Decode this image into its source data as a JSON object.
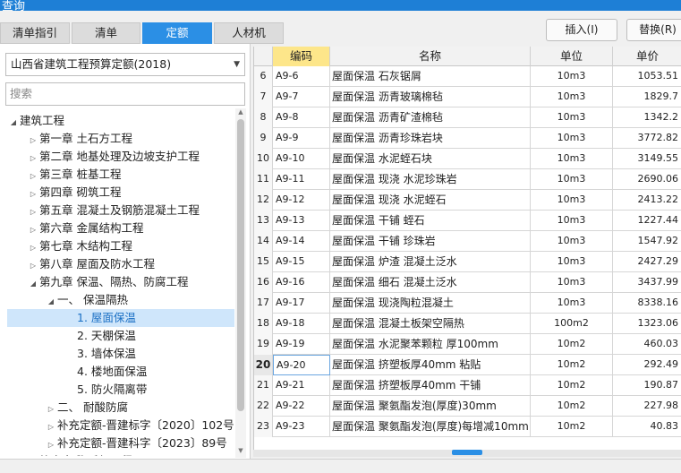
{
  "window": {
    "title": "查询"
  },
  "tabs": [
    {
      "label": "清单指引",
      "active": false
    },
    {
      "label": "清单",
      "active": false
    },
    {
      "label": "定额",
      "active": true
    },
    {
      "label": "人材机",
      "active": false
    }
  ],
  "toolbar": {
    "insert_label": "插入(I)",
    "replace_label": "替换(R)"
  },
  "left": {
    "quota_select": "山西省建筑工程预算定额(2018)",
    "search_placeholder": "搜索"
  },
  "tree": [
    {
      "label": "建筑工程",
      "arrow": "◢",
      "level": 0
    },
    {
      "label": "第一章 土石方工程",
      "arrow": "▷",
      "level": 1
    },
    {
      "label": "第二章 地基处理及边坡支护工程",
      "arrow": "▷",
      "level": 1
    },
    {
      "label": "第三章 桩基工程",
      "arrow": "▷",
      "level": 1
    },
    {
      "label": "第四章 砌筑工程",
      "arrow": "▷",
      "level": 1
    },
    {
      "label": "第五章 混凝土及钢筋混凝土工程",
      "arrow": "▷",
      "level": 1
    },
    {
      "label": "第六章 金属结构工程",
      "arrow": "▷",
      "level": 1
    },
    {
      "label": "第七章 木结构工程",
      "arrow": "▷",
      "level": 1
    },
    {
      "label": "第八章 屋面及防水工程",
      "arrow": "▷",
      "level": 1
    },
    {
      "label": "第九章 保温、隔热、防腐工程",
      "arrow": "◢",
      "level": 1
    },
    {
      "label": "一、 保温隔热",
      "arrow": "◢",
      "level": 2
    },
    {
      "label": "1. 屋面保温",
      "arrow": "",
      "level": 3,
      "selected": true
    },
    {
      "label": "2. 天棚保温",
      "arrow": "",
      "level": 3
    },
    {
      "label": "3. 墙体保温",
      "arrow": "",
      "level": 3
    },
    {
      "label": "4. 楼地面保温",
      "arrow": "",
      "level": 3
    },
    {
      "label": "5. 防火隔离带",
      "arrow": "",
      "level": 3
    },
    {
      "label": "二、 耐酸防腐",
      "arrow": "▷",
      "level": 2
    },
    {
      "label": "补充定额-晋建标字〔2020〕102号",
      "arrow": "▷",
      "level": 2
    },
    {
      "label": "补充定额-晋建科字〔2023〕89号",
      "arrow": "▷",
      "level": 2
    },
    {
      "label": "第十章 脚手架工程",
      "arrow": "",
      "level": 1
    }
  ],
  "grid": {
    "headers": {
      "num": "",
      "code": "编码",
      "name": "名称",
      "unit": "单位",
      "price": "单价"
    },
    "rows": [
      {
        "num": "6",
        "code": "A9-6",
        "name": "屋面保温 石灰锯屑",
        "unit": "10m3",
        "price": "1053.51"
      },
      {
        "num": "7",
        "code": "A9-7",
        "name": "屋面保温 沥青玻璃棉毡",
        "unit": "10m3",
        "price": "1829.7"
      },
      {
        "num": "8",
        "code": "A9-8",
        "name": "屋面保温 沥青矿渣棉毡",
        "unit": "10m3",
        "price": "1342.2"
      },
      {
        "num": "9",
        "code": "A9-9",
        "name": "屋面保温 沥青珍珠岩块",
        "unit": "10m3",
        "price": "3772.82"
      },
      {
        "num": "10",
        "code": "A9-10",
        "name": "屋面保温 水泥蛭石块",
        "unit": "10m3",
        "price": "3149.55"
      },
      {
        "num": "11",
        "code": "A9-11",
        "name": "屋面保温 现浇 水泥珍珠岩",
        "unit": "10m3",
        "price": "2690.06"
      },
      {
        "num": "12",
        "code": "A9-12",
        "name": "屋面保温 现浇 水泥蛭石",
        "unit": "10m3",
        "price": "2413.22"
      },
      {
        "num": "13",
        "code": "A9-13",
        "name": "屋面保温 干铺 蛭石",
        "unit": "10m3",
        "price": "1227.44"
      },
      {
        "num": "14",
        "code": "A9-14",
        "name": "屋面保温 干铺 珍珠岩",
        "unit": "10m3",
        "price": "1547.92"
      },
      {
        "num": "15",
        "code": "A9-15",
        "name": "屋面保温 炉渣 混凝土泛水",
        "unit": "10m3",
        "price": "2427.29"
      },
      {
        "num": "16",
        "code": "A9-16",
        "name": "屋面保温 细石 混凝土泛水",
        "unit": "10m3",
        "price": "3437.99"
      },
      {
        "num": "17",
        "code": "A9-17",
        "name": "屋面保温 现浇陶粒混凝土",
        "unit": "10m3",
        "price": "8338.16"
      },
      {
        "num": "18",
        "code": "A9-18",
        "name": "屋面保温 混凝土板架空隔热",
        "unit": "100m2",
        "price": "1323.06"
      },
      {
        "num": "19",
        "code": "A9-19",
        "name": "屋面保温 水泥聚苯颗粒 厚100mm",
        "unit": "10m2",
        "price": "460.03"
      },
      {
        "num": "20",
        "code": "A9-20",
        "name": "屋面保温 挤塑板厚40mm 粘贴",
        "unit": "10m2",
        "price": "292.49",
        "current": true
      },
      {
        "num": "21",
        "code": "A9-21",
        "name": "屋面保温 挤塑板厚40mm 干铺",
        "unit": "10m2",
        "price": "190.87"
      },
      {
        "num": "22",
        "code": "A9-22",
        "name": "屋面保温 聚氨酯发泡(厚度)30mm",
        "unit": "10m2",
        "price": "227.98"
      },
      {
        "num": "23",
        "code": "A9-23",
        "name": "屋面保温 聚氨酯发泡(厚度)每增减10mm",
        "unit": "10m2",
        "price": "40.83"
      }
    ]
  }
}
